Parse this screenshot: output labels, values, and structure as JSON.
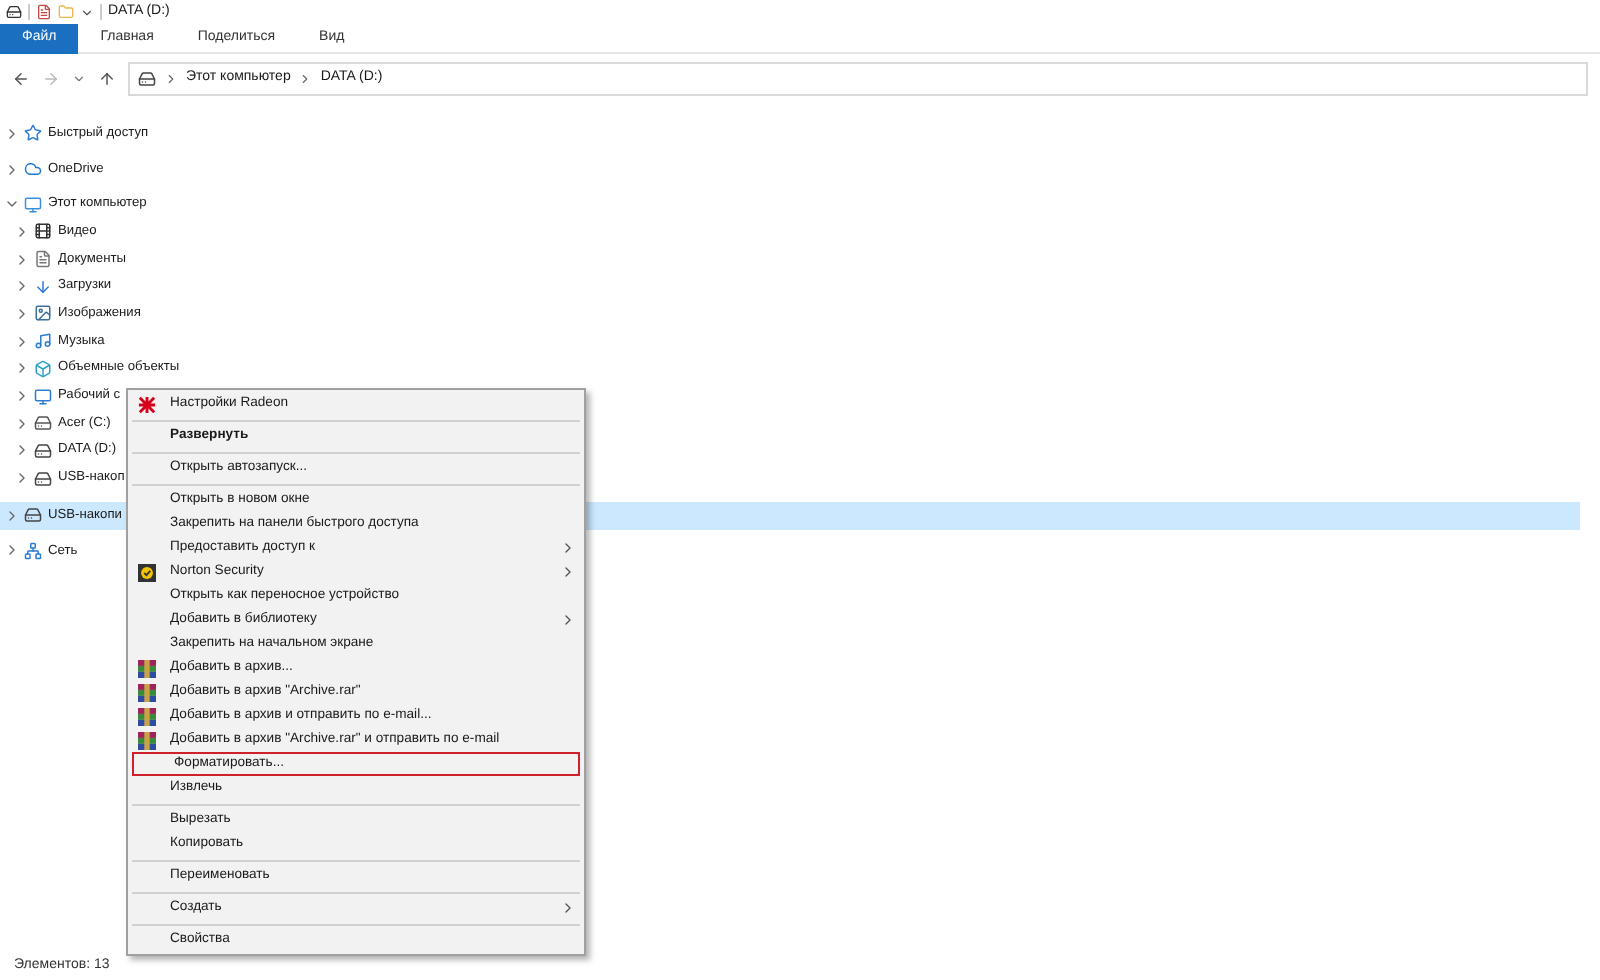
{
  "window": {
    "title": "DATA (D:)"
  },
  "ribbon_tabs": [
    {
      "label": "Файл",
      "selected": true
    },
    {
      "label": "Главная",
      "selected": false
    },
    {
      "label": "Поделиться",
      "selected": false
    },
    {
      "label": "Вид",
      "selected": false
    }
  ],
  "address_bar": {
    "path": [
      "Этот компьютер",
      "DATA (D:)"
    ]
  },
  "tree": [
    {
      "label": "Быстрый доступ",
      "expanded": false,
      "selected": false
    },
    {
      "label": "OneDrive",
      "expanded": false,
      "selected": false
    },
    {
      "label": "Этот компьютер",
      "expanded": true,
      "selected": false,
      "children": [
        {
          "label": "Видео",
          "expanded": false,
          "selected": false
        },
        {
          "label": "Документы",
          "expanded": false,
          "selected": false
        },
        {
          "label": "Загрузки",
          "expanded": false,
          "selected": false
        },
        {
          "label": "Изображения",
          "expanded": false,
          "selected": false
        },
        {
          "label": "Музыка",
          "expanded": false,
          "selected": false
        },
        {
          "label": "Объемные объекты",
          "expanded": false,
          "selected": false
        },
        {
          "label": "Рабочий с",
          "expanded": false,
          "selected": false
        },
        {
          "label": "Acer (C:)",
          "expanded": false,
          "selected": false
        },
        {
          "label": "DATA (D:)",
          "expanded": false,
          "selected": false
        },
        {
          "label": "USB-накоп",
          "expanded": false,
          "selected": false
        }
      ]
    },
    {
      "label": "USB-накопи",
      "expanded": false,
      "selected": true
    },
    {
      "label": "Сеть",
      "expanded": false,
      "selected": false
    }
  ],
  "context_menu": [
    {
      "kind": "item",
      "label": "Настройки Radeon"
    },
    {
      "kind": "separator"
    },
    {
      "kind": "item",
      "label": "Развернуть",
      "bold": true
    },
    {
      "kind": "separator"
    },
    {
      "kind": "item",
      "label": "Открыть автозапуск..."
    },
    {
      "kind": "separator"
    },
    {
      "kind": "item",
      "label": "Открыть в новом окне"
    },
    {
      "kind": "item",
      "label": "Закрепить на панели быстрого доступа"
    },
    {
      "kind": "item",
      "label": "Предоставить доступ к",
      "submenu": true
    },
    {
      "kind": "item",
      "label": "Norton Security",
      "submenu": true
    },
    {
      "kind": "item",
      "label": "Открыть как переносное устройство"
    },
    {
      "kind": "item",
      "label": "Добавить в библиотеку",
      "submenu": true
    },
    {
      "kind": "item",
      "label": "Закрепить на начальном экране"
    },
    {
      "kind": "item",
      "label": "Добавить в архив..."
    },
    {
      "kind": "item",
      "label": "Добавить в архив \"Archive.rar\""
    },
    {
      "kind": "item",
      "label": "Добавить в архив и отправить по e-mail..."
    },
    {
      "kind": "item",
      "label": "Добавить в архив \"Archive.rar\" и отправить по e-mail"
    },
    {
      "kind": "item",
      "label": "Форматировать...",
      "outlined": true
    },
    {
      "kind": "item",
      "label": "Извлечь"
    },
    {
      "kind": "separator"
    },
    {
      "kind": "item",
      "label": "Вырезать"
    },
    {
      "kind": "item",
      "label": "Копировать"
    },
    {
      "kind": "separator"
    },
    {
      "kind": "item",
      "label": "Переименовать"
    },
    {
      "kind": "separator"
    },
    {
      "kind": "item",
      "label": "Создать",
      "submenu": true
    },
    {
      "kind": "separator"
    },
    {
      "kind": "item",
      "label": "Свойства"
    }
  ],
  "status_bar": {
    "items_count": "Элементов: 13"
  }
}
